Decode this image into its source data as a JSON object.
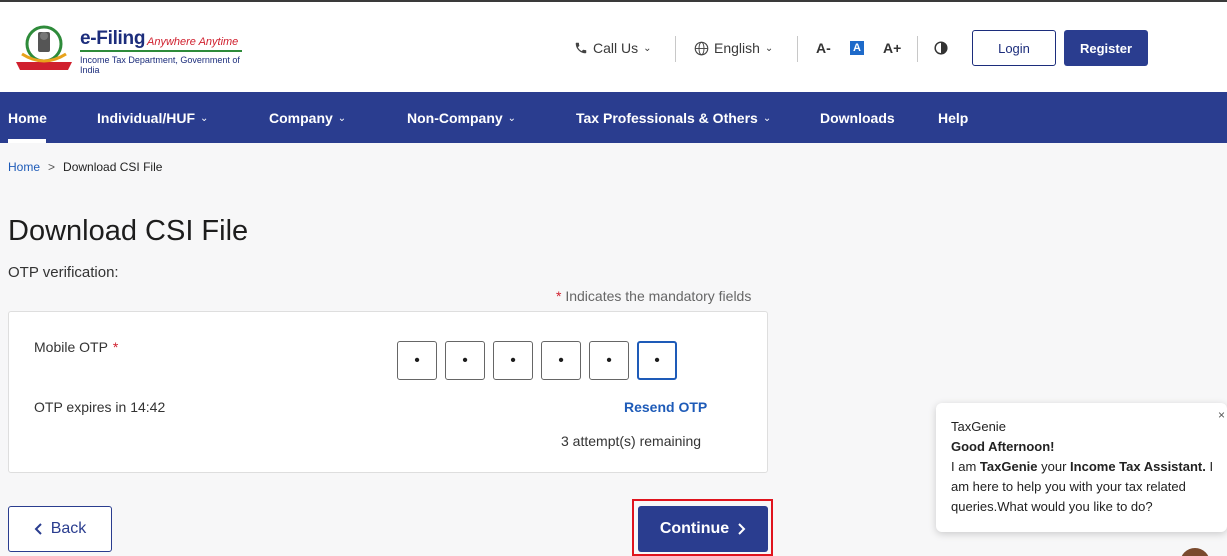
{
  "header": {
    "brand_name": "e-Filing",
    "brand_tag": "Anywhere Anytime",
    "brand_sub": "Income Tax Department, Government of India",
    "call_us": "Call Us",
    "language": "English",
    "font_decrease": "A-",
    "font_normal": "A",
    "font_increase": "A+",
    "login": "Login",
    "register": "Register"
  },
  "nav": {
    "items": [
      {
        "label": "Home"
      },
      {
        "label": "Individual/HUF"
      },
      {
        "label": "Company"
      },
      {
        "label": "Non-Company"
      },
      {
        "label": "Tax Professionals & Others"
      },
      {
        "label": "Downloads"
      },
      {
        "label": "Help"
      }
    ],
    "active": "Home"
  },
  "breadcrumb": {
    "home": "Home",
    "separator": ">",
    "current": "Download CSI File"
  },
  "page": {
    "title": "Download CSI File",
    "subtitle": "OTP verification:",
    "mandatory_star": "*",
    "mandatory_note": "Indicates the mandatory fields"
  },
  "otp": {
    "label": "Mobile OTP",
    "required_star": "*",
    "digits": [
      "•",
      "•",
      "•",
      "•",
      "•",
      "•"
    ],
    "expires": "OTP expires in 14:42",
    "resend": "Resend OTP",
    "attempts": "3 attempt(s) remaining"
  },
  "actions": {
    "back": "Back",
    "continue": "Continue"
  },
  "chat": {
    "name": "TaxGenie",
    "greeting": "Good Afternoon!",
    "intro_prefix": "I am",
    "bot_name": "TaxGenie",
    "your": "your",
    "assistant": "Income Tax Assistant.",
    "message": "I am here to help you with your tax related queries.What would you like to do?"
  },
  "colors": {
    "primary": "#2a3d8f",
    "link": "#1e5bb8",
    "required": "#d0202e",
    "highlight": "#e0141e"
  },
  "icons": [
    "phone-icon",
    "globe-icon",
    "contrast-icon",
    "chevron-down-icon",
    "chevron-left-icon",
    "chevron-right-icon",
    "close-icon"
  ]
}
